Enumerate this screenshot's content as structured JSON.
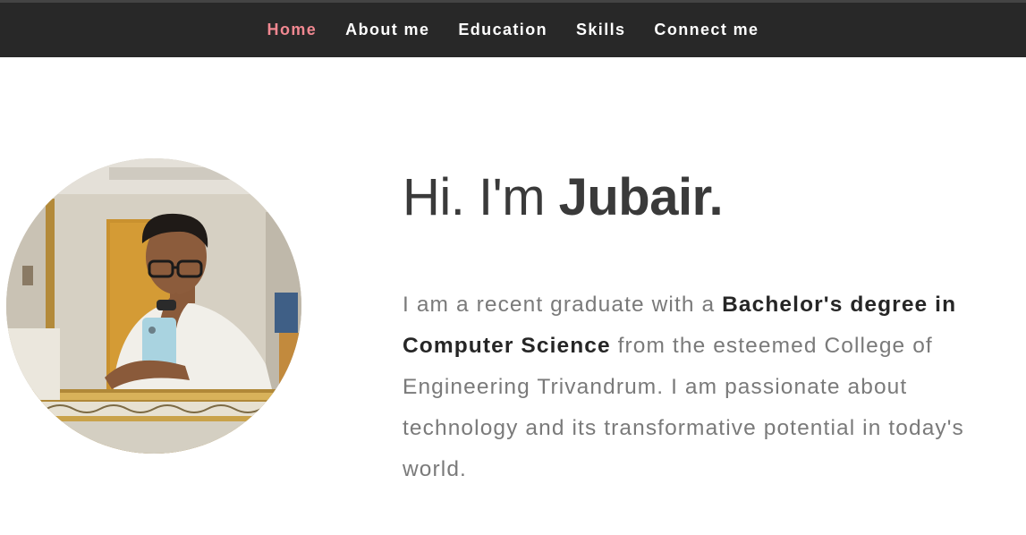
{
  "nav": {
    "items": [
      {
        "label": "Home",
        "active": true
      },
      {
        "label": "About me",
        "active": false
      },
      {
        "label": "Education",
        "active": false
      },
      {
        "label": "Skills",
        "active": false
      },
      {
        "label": "Connect me",
        "active": false
      }
    ]
  },
  "hero": {
    "greeting_prefix": "Hi. I'm ",
    "name": "Jubair.",
    "bio_part1": "I am a recent graduate with a ",
    "bio_bold": "Bachelor's degree in Computer Science",
    "bio_part2": " from the esteemed College of Engineering Trivandrum. I am passionate about technology and its transformative potential in today's world."
  },
  "colors": {
    "navbar_bg": "#282828",
    "nav_active": "#f18891",
    "nav_text": "#ffffff",
    "heading": "#3a3a3a",
    "body_text": "#7a7a7a",
    "bold_text": "#262626"
  }
}
